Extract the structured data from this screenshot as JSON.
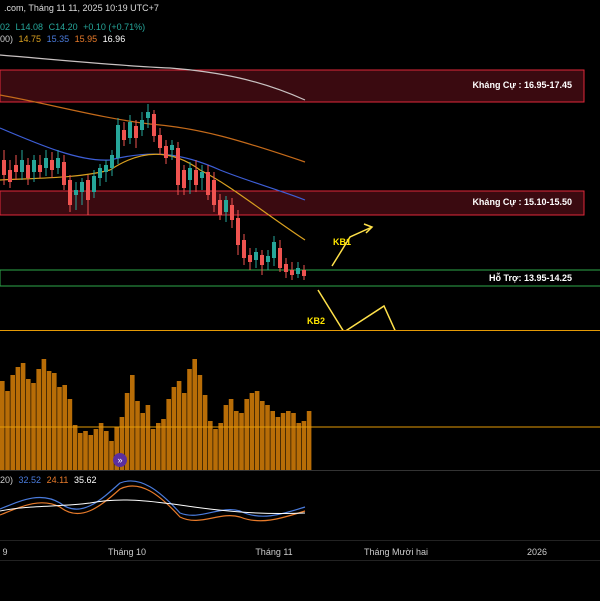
{
  "header": {
    "source_line": ".com, Tháng 11 11, 2025 10:19 UTC+7",
    "ohlc_line": {
      "open_tail": "02",
      "low": "L14.08",
      "close": "C14.20",
      "change": "+0.10 (+0.71%)"
    },
    "ma_line": {
      "prefix": "00)",
      "values": [
        "14.75",
        "15.35",
        "15.95",
        "16.96"
      ]
    }
  },
  "zones": {
    "resistance_high": "Kháng Cự : 16.95-17.45",
    "resistance_mid": "Kháng Cự : 15.10-15.50",
    "support": "Hỗ Trợ: 13.95-14.25"
  },
  "scenarios": {
    "kb1": "KB1",
    "kb2": "KB2"
  },
  "oscillator": {
    "prefix": "20)",
    "values": [
      "32.52",
      "24.11",
      "35.62"
    ]
  },
  "time_axis": [
    "9",
    "Tháng 10",
    "Tháng 11",
    "Tháng Mười hai",
    "2026"
  ],
  "colors": {
    "background": "#000000",
    "resistance_fill": "#3a0a10",
    "resistance_border": "#e0283a",
    "support_border": "#2ea84a",
    "volume": "#b86d07",
    "volume_line": "#e59a06",
    "candle_up": "#26a69a",
    "candle_down": "#ef5350",
    "ma_white": "#c9c2c2",
    "ma_orange": "#c46a1a",
    "ma_blue": "#3d5ed6",
    "ma_amber": "#d9a020",
    "arrow": "#ffe14a",
    "osc_blue": "#4a7bdc",
    "osc_orange": "#e77a2a",
    "osc_white": "#ffffff"
  },
  "icons": {
    "volume_badge": "double-chevron-down-icon"
  }
}
